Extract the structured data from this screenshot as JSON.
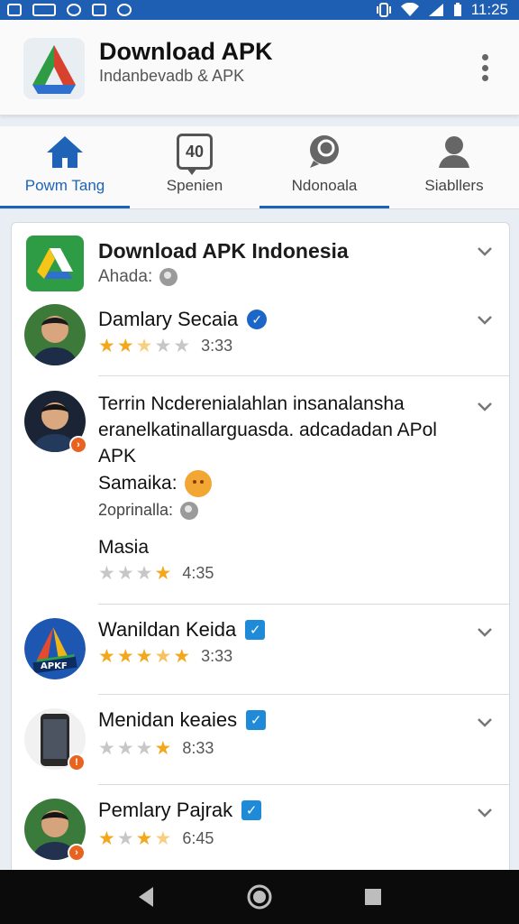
{
  "status_bar": {
    "time": "11:25"
  },
  "app_bar": {
    "title": "Download APK",
    "subtitle": "Indanbevadb & APK"
  },
  "tabs": [
    {
      "label": "Powm Tang",
      "icon": "home-icon",
      "active": true
    },
    {
      "label": "Spenien",
      "icon": "message-badge-icon",
      "badge": "40"
    },
    {
      "label": "Ndonoala",
      "icon": "chat-icon"
    },
    {
      "label": "Siabllers",
      "icon": "person-icon"
    }
  ],
  "header_item": {
    "title": "Download APK Indonesia",
    "subtitle": "Ahada:"
  },
  "items": [
    {
      "name": "Damlary Secaia",
      "rating": 2.5,
      "time": "3:33",
      "verified": true
    },
    {
      "name": "Terrin Ncderenialahlan insanalansha eranelkatinallarguasda. adcadadan APol APK",
      "line1": "Samaika:",
      "line2": "2oprinalla:",
      "extra_name": "Masia",
      "rating": 1,
      "time": "4:35"
    },
    {
      "name": "Wanildan Keida",
      "rating": 4.5,
      "time": "3:33",
      "checked": true,
      "logo_text": "APKF"
    },
    {
      "name": "Menidan keaies",
      "rating": 1,
      "time": "8:33",
      "checked": true
    },
    {
      "name": "Pemlary Pajrak",
      "rating": 2.5,
      "time": "6:45",
      "checked": true
    }
  ],
  "colors": {
    "primary": "#1e63b8",
    "status_bar": "#1e5fb4",
    "star": "#f3a81c",
    "badge": "#e8631f",
    "nav_bar": "#0b0b0b"
  }
}
